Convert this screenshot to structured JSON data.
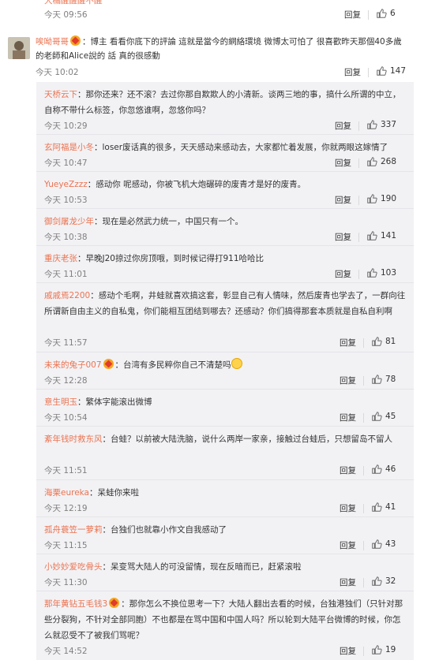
{
  "top": {
    "name": "大橘醒醒醒不醒",
    "text": "：自己没经历过就不要要说哦",
    "time": "今天 09:56",
    "reply_label": "回复",
    "likes": "6"
  },
  "main": {
    "name": "唉呦哥哥",
    "text": "：博主 看看你底下的評論 這就是當今的網絡環境 微博太可怕了 很喜歡昨天那個40多歲的老師和Alice說的 話 真的很感動",
    "time": "今天 10:02",
    "reply_label": "回复",
    "likes": "147"
  },
  "replies": [
    {
      "name": "天桥云下",
      "text": "：那你还来？还不滚？去过你那自欺欺人的小清新。谈两三地的事，搞什么所谓的中立，自称不带什么标签，你忽悠谁啊，忽悠你吗？",
      "time": "今天 10:29",
      "likes": "337"
    },
    {
      "name": "玄阿福是小冬",
      "text": "：loser废话真的很多，天天感动来感动去，大家都忙着发展，你就两眼这嫁情了",
      "time": "今天 10:47",
      "likes": "268"
    },
    {
      "name": "YueyeZzzz",
      "text": "：感动你  呢感动，你被飞机大炮碾碎的废青才是好的废青。",
      "time": "今天 10:53",
      "likes": "190"
    },
    {
      "name": "御剑屠龙少年",
      "text": "：现在是必然武力统一，中国只有一个。",
      "time": "今天 10:38",
      "likes": "141"
    },
    {
      "name": "重庆老张",
      "text": "：早晚J20掠过你房顶哦，到时候记得打911哈哈比",
      "time": "今天 11:01",
      "likes": "103"
    },
    {
      "name": "戚戚焉2200",
      "text": "：感动个毛啊，井蛙就喜欢搞这套，彰显自己有人情味，然后废青也学去了，一群向往所谓新自由主义的自私鬼，你们能相互团结到哪去？还感动？你们搞得那套本质就是自私自利啊",
      "time": "今天 11:57",
      "likes": "81"
    },
    {
      "name": "未来的兔子007",
      "text": "：台湾有多民粹你自己不清楚吗",
      "time": "今天 12:28",
      "likes": "78"
    },
    {
      "name": "意生明玉",
      "text": "：繁体字能滚出微博",
      "time": "今天 10:54",
      "likes": "45"
    },
    {
      "name": "紊年钱时救东风",
      "text": "：台蛙？以前被大陆洗脑，说什么两岸一家亲，接触过台蛙后，只想留岛不留人",
      "time": "今天 11:51",
      "likes": "46"
    },
    {
      "name": "海栗eureka",
      "text": "：呆蛙你来啦",
      "time": "今天 12:19",
      "likes": "41"
    },
    {
      "name": "孤舟蓑笠一萝莉",
      "text": "：台独们也就靠小作文自我感动了",
      "time": "今天 11:15",
      "likes": "43"
    },
    {
      "name": "小妙妙爱吃骨头",
      "text": "：呆变骂大陆人的可没留情，现在反暗而已，赶紧滚啦",
      "time": "今天 11:30",
      "likes": "32"
    },
    {
      "name": "那年黄钻五毛钱3",
      "text": "：那你怎么不换位思考一下？大陆人翻出去看的时候，台独港独们（只针对那些分裂狗，不针对全部同胞）不也都是在骂中国和中国人吗？所以轮到大陆平台微博的时候，你怎么就忍受不了被我们骂呢？",
      "time": "今天 14:52",
      "likes": "19"
    }
  ],
  "reply_label": "回复",
  "colors": {
    "username": "#eb7350",
    "time": "#808080",
    "reply_bg": "#f2f2f5"
  }
}
